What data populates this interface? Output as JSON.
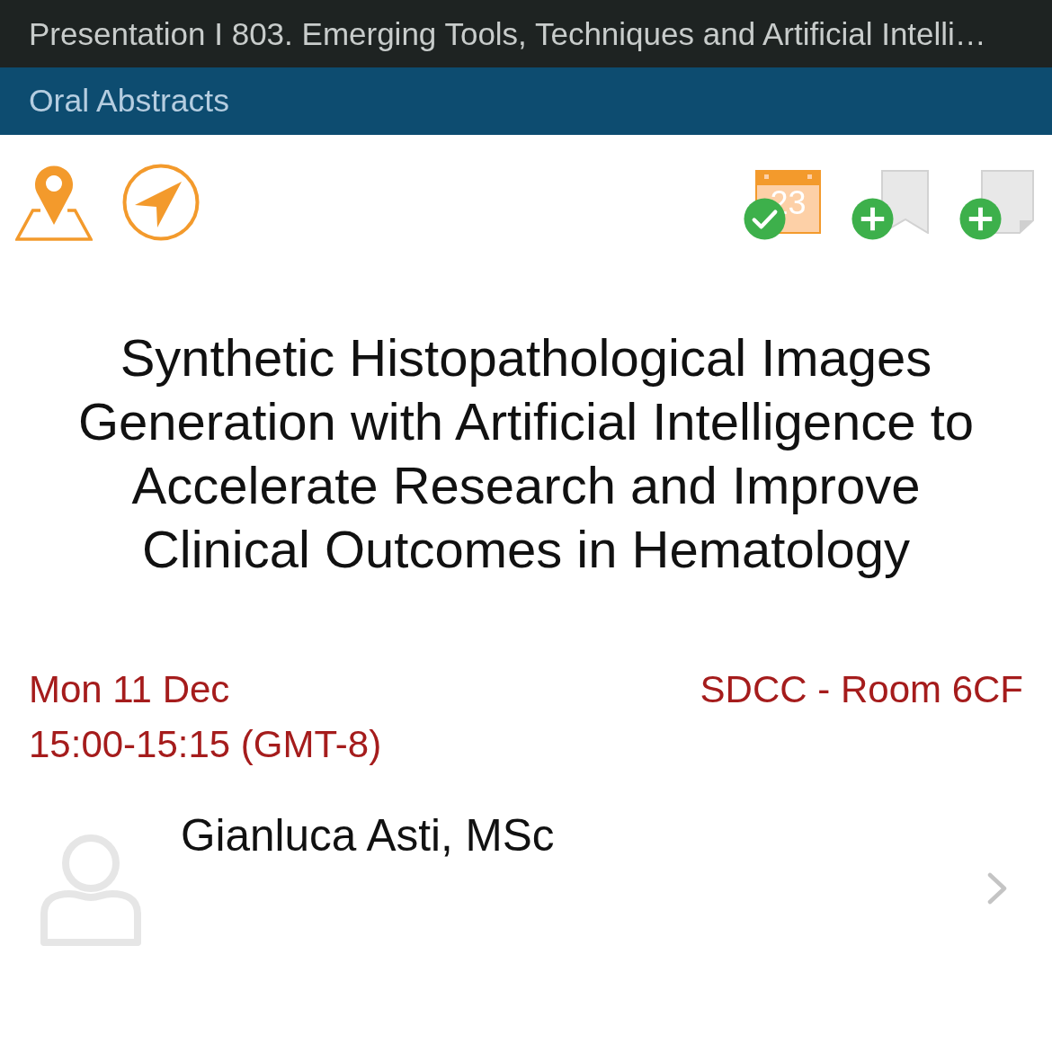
{
  "header": {
    "title": "Presentation I 803. Emerging Tools, Techniques and Artificial Intelli…"
  },
  "session_bar": {
    "label": "Oral Abstracts"
  },
  "location_buttons": [
    {
      "kind": "map"
    },
    {
      "kind": "directions"
    }
  ],
  "actions": [
    {
      "kind": "calendar",
      "day": "23",
      "added": true
    },
    {
      "kind": "bookmark",
      "added": false
    },
    {
      "kind": "note",
      "added": false
    }
  ],
  "title": "Synthetic Histopathological Images Generation with Artificial Intelligence to Accelerate Research and Improve Clinical Outcomes in Hematology",
  "schedule": {
    "date": "Mon 11 Dec",
    "time": "15:00-15:15 (GMT-8)",
    "room": "SDCC - Room 6CF"
  },
  "speakers": [
    {
      "name": "Gianluca Asti, MSc"
    }
  ]
}
